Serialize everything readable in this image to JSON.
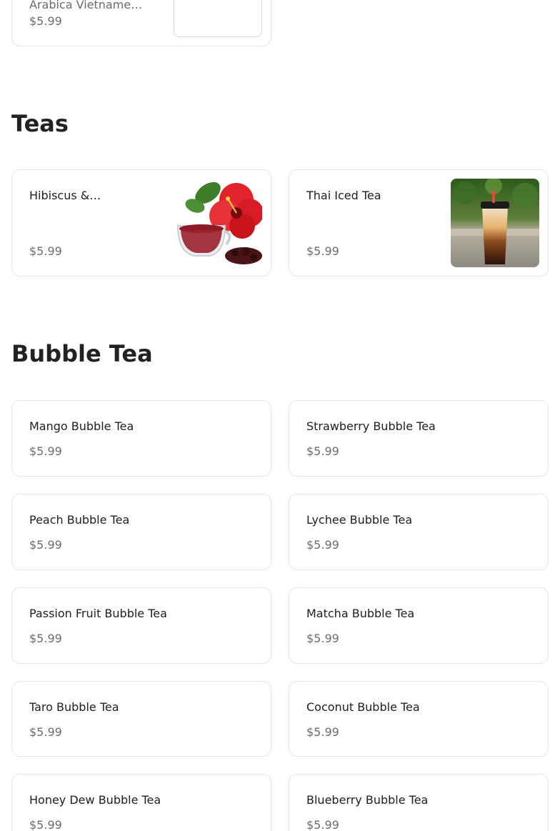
{
  "sections": [
    {
      "title": "Teas"
    },
    {
      "title": "Bubble Tea"
    }
  ],
  "top_item": {
    "name": "Arabica Vietname…",
    "price": "$5.99"
  },
  "teas": [
    {
      "name": "Hibiscus &…",
      "price": "$5.99",
      "image": "hibiscus-tea-photo"
    },
    {
      "name": "Thai Iced Tea",
      "price": "$5.99",
      "image": "thai-iced-tea-photo"
    }
  ],
  "bubble_tea": [
    {
      "name": "Mango Bubble Tea",
      "price": "$5.99"
    },
    {
      "name": "Strawberry Bubble Tea",
      "price": "$5.99"
    },
    {
      "name": "Peach Bubble Tea",
      "price": "$5.99"
    },
    {
      "name": "Lychee Bubble Tea",
      "price": "$5.99"
    },
    {
      "name": "Passion Fruit Bubble Tea",
      "price": "$5.99"
    },
    {
      "name": "Matcha Bubble Tea",
      "price": "$5.99"
    },
    {
      "name": "Taro Bubble Tea",
      "price": "$5.99"
    },
    {
      "name": "Coconut Bubble Tea",
      "price": "$5.99"
    },
    {
      "name": "Honey Dew Bubble Tea",
      "price": "$5.99"
    },
    {
      "name": "Blueberry Bubble Tea",
      "price": "$5.99"
    }
  ]
}
